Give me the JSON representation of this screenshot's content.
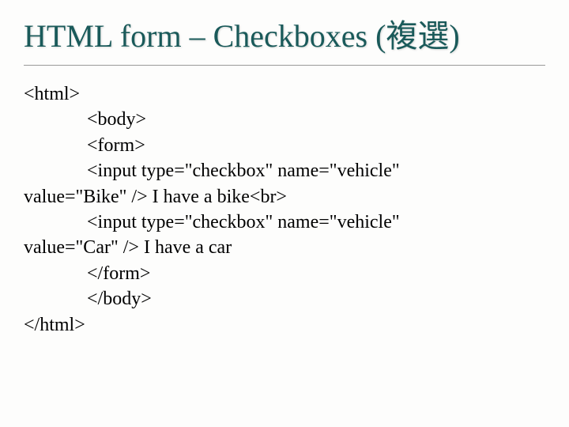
{
  "title": "HTML form – Checkboxes (複選)",
  "lines": [
    {
      "text": "<html>",
      "indent": 0
    },
    {
      "text": "<body>",
      "indent": 1
    },
    {
      "text": "<form>",
      "indent": 1
    },
    {
      "text_pre": "<input type=\"checkbox\" name=\"vehicle\" ",
      "text_wrap": "value=\"Bike\" /> I have a bike<br>",
      "indent": 1,
      "wrap": true
    },
    {
      "text_pre": "<input type=\"checkbox\" name=\"vehicle\" ",
      "text_wrap": "value=\"Car\" /> I have a car",
      "indent": 1,
      "wrap": true
    },
    {
      "text": "</form>",
      "indent": 1
    },
    {
      "text": "</body>",
      "indent": 1
    },
    {
      "text": "</html>",
      "indent": 0
    }
  ]
}
